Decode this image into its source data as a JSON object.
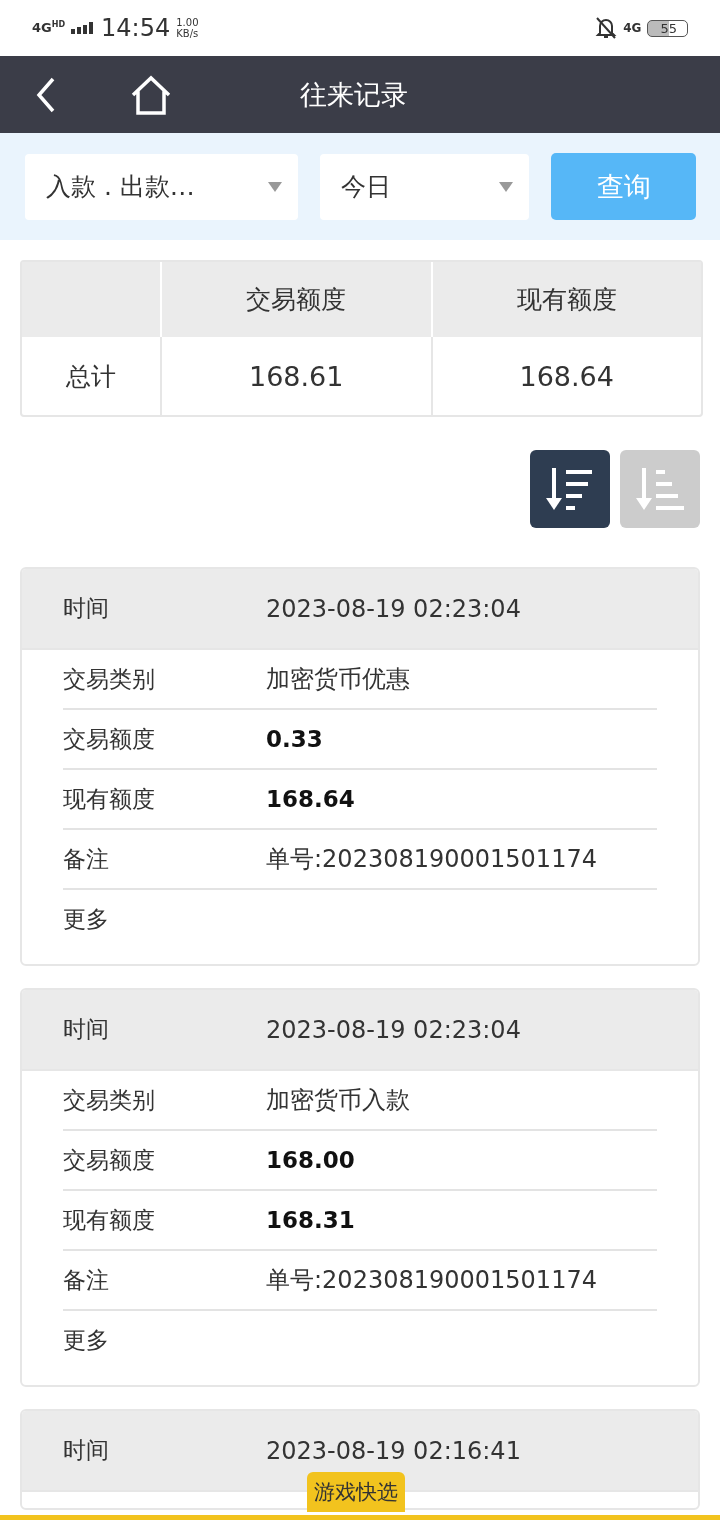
{
  "status_bar": {
    "network": "4G",
    "network_sup": "HD",
    "time": "14:54",
    "speed_value": "1.00",
    "speed_unit": "KB/s",
    "right_network": "4G",
    "battery": "55"
  },
  "header": {
    "title": "往来记录"
  },
  "filters": [
    {
      "value": "入款 . 出款…"
    },
    {
      "value": "今日"
    }
  ],
  "query_button": "查询",
  "summary": {
    "columns": [
      "交易额度",
      "现有额度"
    ],
    "row_label": "总计",
    "values": [
      "168.61",
      "168.64"
    ]
  },
  "sort_buttons": [
    {
      "selected": true
    },
    {
      "selected": false
    }
  ],
  "records": [
    {
      "time_label": "时间",
      "time": "2023-08-19 02:23:04",
      "rows": [
        {
          "label": "交易类别",
          "value": "加密货币优惠",
          "bold": false
        },
        {
          "label": "交易额度",
          "value": "0.33",
          "bold": true
        },
        {
          "label": "现有额度",
          "value": "168.64",
          "bold": true
        },
        {
          "label": "备注",
          "value": "单号:202308190001501174",
          "bold": false
        }
      ],
      "more": "更多"
    },
    {
      "time_label": "时间",
      "time": "2023-08-19 02:23:04",
      "rows": [
        {
          "label": "交易类别",
          "value": "加密货币入款",
          "bold": false
        },
        {
          "label": "交易额度",
          "value": "168.00",
          "bold": true
        },
        {
          "label": "现有额度",
          "value": "168.31",
          "bold": true
        },
        {
          "label": "备注",
          "value": "单号:202308190001501174",
          "bold": false
        }
      ],
      "more": "更多"
    },
    {
      "time_label": "时间",
      "time": "2023-08-19 02:16:41"
    }
  ],
  "floating_badge": "游戏快选"
}
